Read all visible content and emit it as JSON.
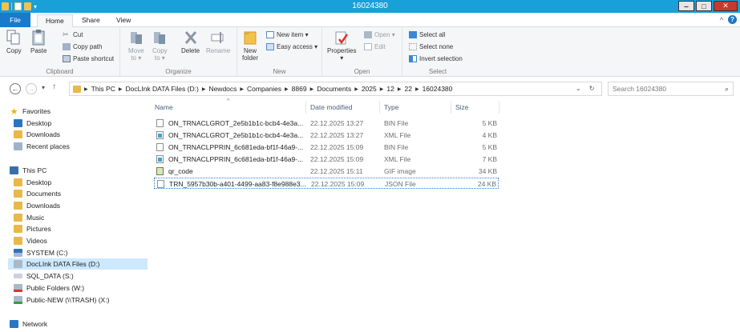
{
  "window": {
    "title": "16024380",
    "minimize": "‒",
    "maximize": "□",
    "close": "✕"
  },
  "tabs": {
    "file": "File",
    "home": "Home",
    "share": "Share",
    "view": "View",
    "collapse": "^",
    "help": "?"
  },
  "ribbon": {
    "clipboard": {
      "label": "Clipboard",
      "copy": "Copy",
      "paste": "Paste",
      "cut": "Cut",
      "copy_path": "Copy path",
      "paste_shortcut": "Paste shortcut"
    },
    "organize": {
      "label": "Organize",
      "move_to": "Move",
      "move_to_2": "to ▾",
      "copy_to": "Copy",
      "copy_to_2": "to ▾",
      "delete": "Delete",
      "rename": "Rename"
    },
    "new": {
      "label": "New",
      "new_folder": "New",
      "new_folder_2": "folder",
      "new_item": "New item ▾",
      "easy_access": "Easy access ▾"
    },
    "open": {
      "label": "Open",
      "properties": "Properties",
      "properties_2": "▾",
      "open": "Open ▾",
      "edit": "Edit"
    },
    "select": {
      "label": "Select",
      "select_all": "Select all",
      "select_none": "Select none",
      "invert": "Invert selection"
    }
  },
  "address": {
    "back": "←",
    "forward": "→",
    "recent": "▾",
    "up": "↑",
    "crumbs": [
      "This PC",
      "DocLInk DATA Files (D:)",
      "Newdocs",
      "Companies",
      "8869",
      "Documents",
      "2025",
      "12",
      "22",
      "16024380"
    ],
    "dropdown": "⌄",
    "refresh": "↻",
    "search_placeholder": "Search 16024380",
    "search_icon": "⌕"
  },
  "nav": {
    "favorites": "Favorites",
    "fav_items": [
      "Desktop",
      "Downloads",
      "Recent places"
    ],
    "this_pc": "This PC",
    "pc_items": [
      "Desktop",
      "Documents",
      "Downloads",
      "Music",
      "Pictures",
      "Videos",
      "SYSTEM (C:)",
      "DocLInk DATA Files (D:)",
      "SQL_DATA (S:)",
      "Public Folders (W:)",
      "Public-NEW (\\\\TRASH) (X:)"
    ],
    "network": "Network"
  },
  "columns": {
    "name": "Name",
    "date": "Date modified",
    "type": "Type",
    "size": "Size",
    "sort_indicator": "^"
  },
  "files": [
    {
      "name": "ON_TRNACLGROT_2e5b1b1c-bcb4-4e3a...",
      "date": "22.12.2025 13:27",
      "type": "BIN File",
      "size": "5 KB",
      "icon": "bin"
    },
    {
      "name": "ON_TRNACLGROT_2e5b1b1c-bcb4-4e3a...",
      "date": "22.12.2025 13:27",
      "type": "XML File",
      "size": "4 KB",
      "icon": "xml"
    },
    {
      "name": "ON_TRNACLPPRIN_6c681eda-bf1f-46a9-...",
      "date": "22.12.2025 15:09",
      "type": "BIN File",
      "size": "5 KB",
      "icon": "bin"
    },
    {
      "name": "ON_TRNACLPPRIN_6c681eda-bf1f-46a9-...",
      "date": "22.12.2025 15:09",
      "type": "XML File",
      "size": "7 KB",
      "icon": "xml"
    },
    {
      "name": "qr_code",
      "date": "22.12.2025 15:11",
      "type": "GIF image",
      "size": "34 KB",
      "icon": "gif"
    },
    {
      "name": "TRN_5957b30b-a401-4499-aa83-f8e988e3...",
      "date": "22.12.2025 15:09",
      "type": "JSON File",
      "size": "24 KB",
      "icon": "json"
    }
  ],
  "colors": {
    "titlebar": "#19a0d8",
    "file_tab": "#1979ca",
    "selected_nav": "#cde8ff"
  }
}
